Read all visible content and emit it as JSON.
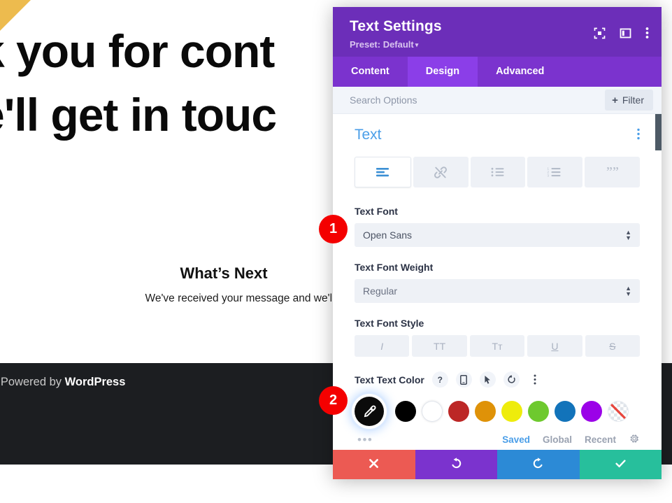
{
  "background": {
    "heading_line1": "k you for cont",
    "heading_line2": "e'll get in touc",
    "whats_next_title": "What’s Next",
    "whats_next_body": "We've received your message and we'll send you an email within",
    "footer_prefix": "| Powered by ",
    "footer_brand": "WordPress",
    "corner_color": "#edbb4e",
    "footer_bg": "#1c1e21"
  },
  "panel": {
    "title": "Text Settings",
    "preset_label": "Preset: Default",
    "preset_caret": "▾",
    "header_bg": "#6c2eb9",
    "accent": "#8b3ee8",
    "header_icons": [
      {
        "name": "focus-icon",
        "label": "focus"
      },
      {
        "name": "layout-panel-icon",
        "label": "layout"
      },
      {
        "name": "kebab-menu-icon",
        "label": "more"
      }
    ],
    "tabs": [
      {
        "label": "Content",
        "active": false
      },
      {
        "label": "Design",
        "active": true
      },
      {
        "label": "Advanced",
        "active": false
      }
    ],
    "search": {
      "placeholder": "Search Options",
      "value": "",
      "filter_label": "Filter",
      "filter_plus": "+"
    },
    "section": {
      "title": "Text",
      "menu_icon": "kebab-menu-icon"
    },
    "align_toolbar": [
      {
        "name": "text-align-icon",
        "active": true
      },
      {
        "name": "link-icon",
        "active": false
      },
      {
        "name": "unordered-list-icon",
        "active": false
      },
      {
        "name": "ordered-list-icon",
        "active": false
      },
      {
        "name": "blockquote-icon",
        "active": false
      }
    ],
    "fields": {
      "font": {
        "label": "Text Font",
        "value": "Open Sans"
      },
      "font_weight": {
        "label": "Text Font Weight",
        "value": "Regular"
      },
      "font_style": {
        "label": "Text Font Style",
        "buttons": [
          {
            "name": "italic-button",
            "glyph": "I"
          },
          {
            "name": "uppercase-button",
            "glyph": "TT"
          },
          {
            "name": "small-caps-button",
            "glyph": "Tᴛ"
          },
          {
            "name": "underline-button",
            "glyph": "U"
          },
          {
            "name": "strikethrough-button",
            "glyph": "S"
          }
        ]
      }
    },
    "color": {
      "label": "Text Text Color",
      "head_icons": [
        {
          "name": "help-icon",
          "glyph": "?"
        },
        {
          "name": "responsive-mobile-icon",
          "glyph": ""
        },
        {
          "name": "hover-cursor-icon",
          "glyph": ""
        },
        {
          "name": "reset-icon",
          "glyph": ""
        },
        {
          "name": "kebab-menu-icon",
          "glyph": ""
        }
      ],
      "eyedropper_name": "eyedropper-button",
      "swatches": [
        {
          "name": "swatch-black",
          "hex": "#000000"
        },
        {
          "name": "swatch-white",
          "hex": "#ffffff"
        },
        {
          "name": "swatch-red",
          "hex": "#bc2726"
        },
        {
          "name": "swatch-orange",
          "hex": "#df9208"
        },
        {
          "name": "swatch-yellow",
          "hex": "#eeec0c"
        },
        {
          "name": "swatch-green",
          "hex": "#6ec92e"
        },
        {
          "name": "swatch-blue",
          "hex": "#1273ba"
        },
        {
          "name": "swatch-purple",
          "hex": "#9b02e8"
        },
        {
          "name": "swatch-transparent",
          "hex": "transparent"
        }
      ],
      "more_dots": "•••",
      "tabs": [
        {
          "label": "Saved",
          "active": true
        },
        {
          "label": "Global",
          "active": false
        },
        {
          "label": "Recent",
          "active": false
        }
      ],
      "settings_icon": "gear-icon"
    },
    "actions": [
      {
        "name": "cancel-button",
        "icon": "close-icon",
        "color": "#ec5a53"
      },
      {
        "name": "undo-button",
        "icon": "undo-icon",
        "color": "#7b33ce"
      },
      {
        "name": "redo-button",
        "icon": "redo-icon",
        "color": "#2c8ad6"
      },
      {
        "name": "save-button",
        "icon": "check-icon",
        "color": "#27bf9c"
      }
    ]
  },
  "annotations": [
    {
      "number": "1"
    },
    {
      "number": "2"
    }
  ]
}
